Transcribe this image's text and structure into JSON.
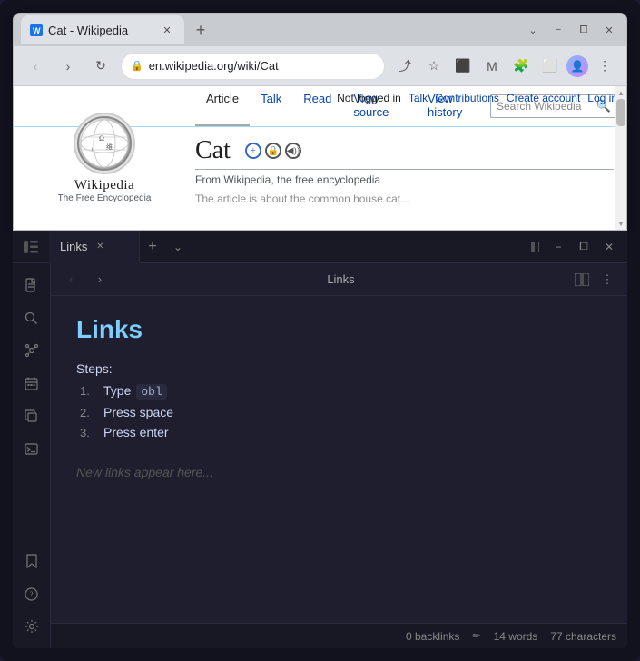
{
  "browser": {
    "tab_label": "Cat - Wikipedia",
    "tab_new_label": "+",
    "url": "en.wikipedia.org/wiki/Cat",
    "nav": {
      "back": "‹",
      "forward": "›",
      "reload": "↻"
    },
    "toolbar": {
      "share": "⤴",
      "star": "☆",
      "extensions_1": "⬛",
      "extensions_2": "M",
      "puzzle": "🧩",
      "sidebar": "⬜",
      "profile": "👤",
      "more": "⋮"
    },
    "win_controls": {
      "dropdown": "⌄",
      "minimize": "−",
      "restore": "⧠",
      "close": "✕"
    }
  },
  "wikipedia": {
    "logo_letter": "W",
    "brand_name": "Wikipedia",
    "brand_sub": "The Free Encyclopedia",
    "user_bar": {
      "not_logged": "Not logged in",
      "talk": "Talk",
      "contributions": "Contributions",
      "create_account": "Create account",
      "log_in": "Log in"
    },
    "tabs": [
      "Article",
      "Talk"
    ],
    "actions": [
      "Read",
      "View source",
      "View history"
    ],
    "search_placeholder": "Search Wikipedia",
    "article_title": "Cat",
    "tagline": "From Wikipedia, the free encyclopedia",
    "first_para": "The article is about the common house cat..."
  },
  "obsidian": {
    "tab_label": "Links",
    "editor_title": "Links",
    "page_title": "Links",
    "back": "‹",
    "forward": "›",
    "steps_label": "Steps:",
    "steps": [
      {
        "num": "1.",
        "text": "Type ",
        "code": "obl",
        "suffix": ""
      },
      {
        "num": "2.",
        "text": "Press space",
        "code": "",
        "suffix": ""
      },
      {
        "num": "3.",
        "text": "Press enter",
        "code": "",
        "suffix": ""
      }
    ],
    "placeholder": "New links appear here...",
    "status": {
      "backlinks": "0 backlinks",
      "words": "14 words",
      "chars": "77 characters"
    },
    "icons": {
      "sidebar": "☰",
      "files": "📄",
      "search": "🔍",
      "graph": "⬡",
      "calendar": "📅",
      "copy": "⧉",
      "terminal": ">_",
      "bookmark": "⊡",
      "help": "?",
      "settings": "⚙",
      "split": "⧈",
      "more": "⋮",
      "minimize": "−",
      "restore": "⧠",
      "close": "✕",
      "tab_close": "✕",
      "new_tab": "+",
      "dropdown": "⌄"
    }
  }
}
